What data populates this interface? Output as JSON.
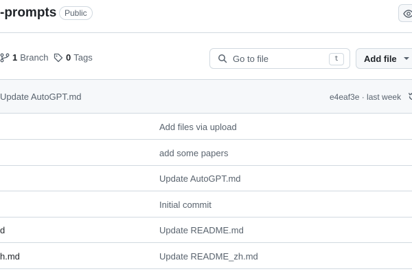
{
  "repo": {
    "title": "-prompts",
    "visibility": "Public"
  },
  "meta": {
    "branches_count": "1",
    "branches_label": "Branch",
    "tags_count": "0",
    "tags_label": "Tags"
  },
  "search": {
    "placeholder": "Go to file",
    "shortcut": "t"
  },
  "add_file": {
    "label": "Add file"
  },
  "latest_commit": {
    "message": "Update AutoGPT.md",
    "meta": "e4eaf3e · last week"
  },
  "files": [
    {
      "name": "",
      "message": "Add files via upload"
    },
    {
      "name": "",
      "message": "add some papers"
    },
    {
      "name": "",
      "message": "Update AutoGPT.md"
    },
    {
      "name": "",
      "message": "Initial commit"
    },
    {
      "name": "d",
      "message": "Update README.md"
    },
    {
      "name": "h.md",
      "message": "Update README_zh.md"
    }
  ],
  "icons": {
    "watch": "eye-icon",
    "branch": "git-branch-icon",
    "tag": "tag-icon",
    "search": "search-icon",
    "add_caret": "triangle-down-icon",
    "history": "history-icon"
  },
  "colors": {
    "text": "#1f2328",
    "muted": "#59636e",
    "border": "#d1d9e0",
    "subtle_bg": "#f6f8fa"
  }
}
